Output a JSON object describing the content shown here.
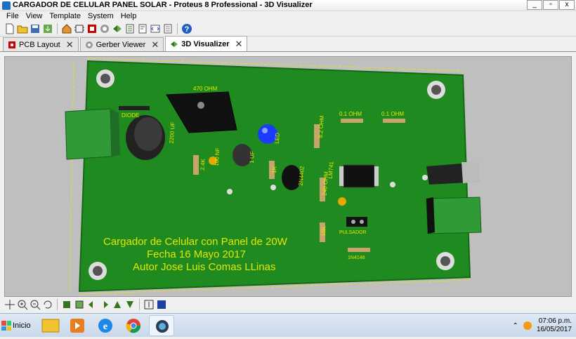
{
  "window": {
    "title": "CARGADOR DE CELULAR PANEL SOLAR - Proteus 8 Professional - 3D Visualizer",
    "controls": [
      "_",
      "▫",
      "x"
    ]
  },
  "menu": [
    "File",
    "View",
    "Template",
    "System",
    "Help"
  ],
  "tabs": [
    {
      "label": "PCB Layout",
      "icon": "pcb-icon",
      "active": false
    },
    {
      "label": "Gerber Viewer",
      "icon": "gerber-icon",
      "active": false
    },
    {
      "label": "3D Visualizer",
      "icon": "visualizer-icon",
      "active": true
    }
  ],
  "board": {
    "text_lines": [
      "Cargador de Celular con Panel de 20W",
      "Fecha 16 Mayo 2017",
      "Autor Jose Luis Comas LLinas"
    ],
    "labels": {
      "diode": "DIODE",
      "res_470": "470 OHM",
      "cap_2200": "2200 UF",
      "res_24k": "2.4K",
      "cap_100nf": "100 NF",
      "cap_1uf": "1 UF",
      "res_1k": "1K",
      "led": "LED",
      "res_8k2": "8.2 OHM",
      "res_01a": "0.1 OHM",
      "res_01b": "0.1 OHM",
      "transistor": "2N4402",
      "res_240": "240 OHM",
      "ic": "LM741",
      "res_15k": "15K",
      "button": "PULSADOR",
      "diode2": "1N4148"
    },
    "colors": {
      "pcb": "#1f8a1f",
      "silk": "#e6e600",
      "connector": "#2f9a36",
      "led": "#1a3cff",
      "background": "#bfbfbf"
    }
  },
  "taskbar": {
    "start_label": "Inicio",
    "time": "07:06 p.m.",
    "date": "16/05/2017"
  }
}
